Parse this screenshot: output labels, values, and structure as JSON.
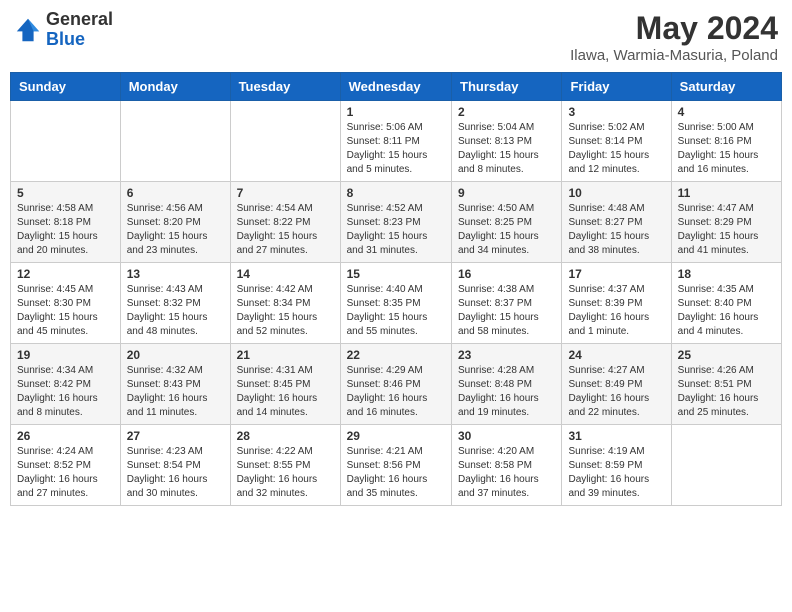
{
  "header": {
    "logo_general": "General",
    "logo_blue": "Blue",
    "month_title": "May 2024",
    "location": "Ilawa, Warmia-Masuria, Poland"
  },
  "days_of_week": [
    "Sunday",
    "Monday",
    "Tuesday",
    "Wednesday",
    "Thursday",
    "Friday",
    "Saturday"
  ],
  "weeks": [
    [
      {
        "day": "",
        "sunrise": "",
        "sunset": "",
        "daylight": ""
      },
      {
        "day": "",
        "sunrise": "",
        "sunset": "",
        "daylight": ""
      },
      {
        "day": "",
        "sunrise": "",
        "sunset": "",
        "daylight": ""
      },
      {
        "day": "1",
        "sunrise": "Sunrise: 5:06 AM",
        "sunset": "Sunset: 8:11 PM",
        "daylight": "Daylight: 15 hours and 5 minutes."
      },
      {
        "day": "2",
        "sunrise": "Sunrise: 5:04 AM",
        "sunset": "Sunset: 8:13 PM",
        "daylight": "Daylight: 15 hours and 8 minutes."
      },
      {
        "day": "3",
        "sunrise": "Sunrise: 5:02 AM",
        "sunset": "Sunset: 8:14 PM",
        "daylight": "Daylight: 15 hours and 12 minutes."
      },
      {
        "day": "4",
        "sunrise": "Sunrise: 5:00 AM",
        "sunset": "Sunset: 8:16 PM",
        "daylight": "Daylight: 15 hours and 16 minutes."
      }
    ],
    [
      {
        "day": "5",
        "sunrise": "Sunrise: 4:58 AM",
        "sunset": "Sunset: 8:18 PM",
        "daylight": "Daylight: 15 hours and 20 minutes."
      },
      {
        "day": "6",
        "sunrise": "Sunrise: 4:56 AM",
        "sunset": "Sunset: 8:20 PM",
        "daylight": "Daylight: 15 hours and 23 minutes."
      },
      {
        "day": "7",
        "sunrise": "Sunrise: 4:54 AM",
        "sunset": "Sunset: 8:22 PM",
        "daylight": "Daylight: 15 hours and 27 minutes."
      },
      {
        "day": "8",
        "sunrise": "Sunrise: 4:52 AM",
        "sunset": "Sunset: 8:23 PM",
        "daylight": "Daylight: 15 hours and 31 minutes."
      },
      {
        "day": "9",
        "sunrise": "Sunrise: 4:50 AM",
        "sunset": "Sunset: 8:25 PM",
        "daylight": "Daylight: 15 hours and 34 minutes."
      },
      {
        "day": "10",
        "sunrise": "Sunrise: 4:48 AM",
        "sunset": "Sunset: 8:27 PM",
        "daylight": "Daylight: 15 hours and 38 minutes."
      },
      {
        "day": "11",
        "sunrise": "Sunrise: 4:47 AM",
        "sunset": "Sunset: 8:29 PM",
        "daylight": "Daylight: 15 hours and 41 minutes."
      }
    ],
    [
      {
        "day": "12",
        "sunrise": "Sunrise: 4:45 AM",
        "sunset": "Sunset: 8:30 PM",
        "daylight": "Daylight: 15 hours and 45 minutes."
      },
      {
        "day": "13",
        "sunrise": "Sunrise: 4:43 AM",
        "sunset": "Sunset: 8:32 PM",
        "daylight": "Daylight: 15 hours and 48 minutes."
      },
      {
        "day": "14",
        "sunrise": "Sunrise: 4:42 AM",
        "sunset": "Sunset: 8:34 PM",
        "daylight": "Daylight: 15 hours and 52 minutes."
      },
      {
        "day": "15",
        "sunrise": "Sunrise: 4:40 AM",
        "sunset": "Sunset: 8:35 PM",
        "daylight": "Daylight: 15 hours and 55 minutes."
      },
      {
        "day": "16",
        "sunrise": "Sunrise: 4:38 AM",
        "sunset": "Sunset: 8:37 PM",
        "daylight": "Daylight: 15 hours and 58 minutes."
      },
      {
        "day": "17",
        "sunrise": "Sunrise: 4:37 AM",
        "sunset": "Sunset: 8:39 PM",
        "daylight": "Daylight: 16 hours and 1 minute."
      },
      {
        "day": "18",
        "sunrise": "Sunrise: 4:35 AM",
        "sunset": "Sunset: 8:40 PM",
        "daylight": "Daylight: 16 hours and 4 minutes."
      }
    ],
    [
      {
        "day": "19",
        "sunrise": "Sunrise: 4:34 AM",
        "sunset": "Sunset: 8:42 PM",
        "daylight": "Daylight: 16 hours and 8 minutes."
      },
      {
        "day": "20",
        "sunrise": "Sunrise: 4:32 AM",
        "sunset": "Sunset: 8:43 PM",
        "daylight": "Daylight: 16 hours and 11 minutes."
      },
      {
        "day": "21",
        "sunrise": "Sunrise: 4:31 AM",
        "sunset": "Sunset: 8:45 PM",
        "daylight": "Daylight: 16 hours and 14 minutes."
      },
      {
        "day": "22",
        "sunrise": "Sunrise: 4:29 AM",
        "sunset": "Sunset: 8:46 PM",
        "daylight": "Daylight: 16 hours and 16 minutes."
      },
      {
        "day": "23",
        "sunrise": "Sunrise: 4:28 AM",
        "sunset": "Sunset: 8:48 PM",
        "daylight": "Daylight: 16 hours and 19 minutes."
      },
      {
        "day": "24",
        "sunrise": "Sunrise: 4:27 AM",
        "sunset": "Sunset: 8:49 PM",
        "daylight": "Daylight: 16 hours and 22 minutes."
      },
      {
        "day": "25",
        "sunrise": "Sunrise: 4:26 AM",
        "sunset": "Sunset: 8:51 PM",
        "daylight": "Daylight: 16 hours and 25 minutes."
      }
    ],
    [
      {
        "day": "26",
        "sunrise": "Sunrise: 4:24 AM",
        "sunset": "Sunset: 8:52 PM",
        "daylight": "Daylight: 16 hours and 27 minutes."
      },
      {
        "day": "27",
        "sunrise": "Sunrise: 4:23 AM",
        "sunset": "Sunset: 8:54 PM",
        "daylight": "Daylight: 16 hours and 30 minutes."
      },
      {
        "day": "28",
        "sunrise": "Sunrise: 4:22 AM",
        "sunset": "Sunset: 8:55 PM",
        "daylight": "Daylight: 16 hours and 32 minutes."
      },
      {
        "day": "29",
        "sunrise": "Sunrise: 4:21 AM",
        "sunset": "Sunset: 8:56 PM",
        "daylight": "Daylight: 16 hours and 35 minutes."
      },
      {
        "day": "30",
        "sunrise": "Sunrise: 4:20 AM",
        "sunset": "Sunset: 8:58 PM",
        "daylight": "Daylight: 16 hours and 37 minutes."
      },
      {
        "day": "31",
        "sunrise": "Sunrise: 4:19 AM",
        "sunset": "Sunset: 8:59 PM",
        "daylight": "Daylight: 16 hours and 39 minutes."
      },
      {
        "day": "",
        "sunrise": "",
        "sunset": "",
        "daylight": ""
      }
    ]
  ]
}
